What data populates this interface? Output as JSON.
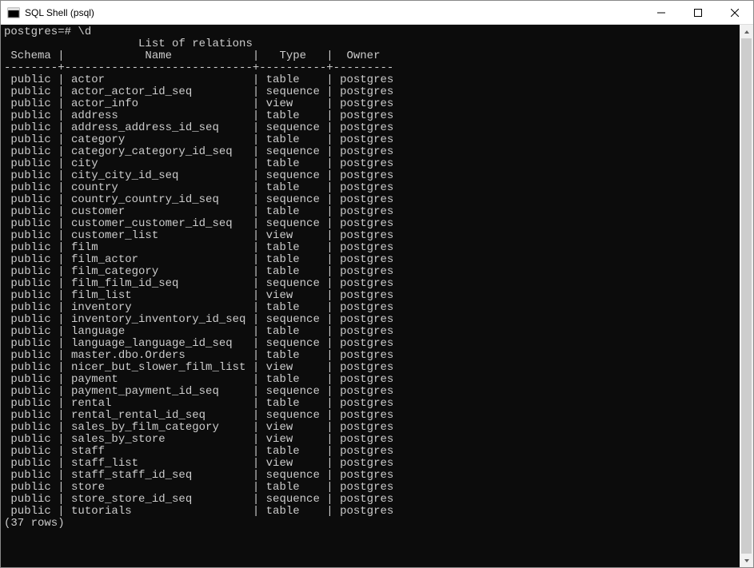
{
  "window": {
    "title": "SQL Shell (psql)"
  },
  "terminal": {
    "prompt": "postgres=# \\d",
    "list_title": "List of relations",
    "columns": {
      "schema": "Schema",
      "name": "Name",
      "type": "Type",
      "owner": "Owner"
    },
    "col_widths": {
      "schema": 8,
      "name": 28,
      "type": 10,
      "owner": 9
    },
    "rows": [
      {
        "schema": "public",
        "name": "actor",
        "type": "table",
        "owner": "postgres"
      },
      {
        "schema": "public",
        "name": "actor_actor_id_seq",
        "type": "sequence",
        "owner": "postgres"
      },
      {
        "schema": "public",
        "name": "actor_info",
        "type": "view",
        "owner": "postgres"
      },
      {
        "schema": "public",
        "name": "address",
        "type": "table",
        "owner": "postgres"
      },
      {
        "schema": "public",
        "name": "address_address_id_seq",
        "type": "sequence",
        "owner": "postgres"
      },
      {
        "schema": "public",
        "name": "category",
        "type": "table",
        "owner": "postgres"
      },
      {
        "schema": "public",
        "name": "category_category_id_seq",
        "type": "sequence",
        "owner": "postgres"
      },
      {
        "schema": "public",
        "name": "city",
        "type": "table",
        "owner": "postgres"
      },
      {
        "schema": "public",
        "name": "city_city_id_seq",
        "type": "sequence",
        "owner": "postgres"
      },
      {
        "schema": "public",
        "name": "country",
        "type": "table",
        "owner": "postgres"
      },
      {
        "schema": "public",
        "name": "country_country_id_seq",
        "type": "sequence",
        "owner": "postgres"
      },
      {
        "schema": "public",
        "name": "customer",
        "type": "table",
        "owner": "postgres"
      },
      {
        "schema": "public",
        "name": "customer_customer_id_seq",
        "type": "sequence",
        "owner": "postgres"
      },
      {
        "schema": "public",
        "name": "customer_list",
        "type": "view",
        "owner": "postgres"
      },
      {
        "schema": "public",
        "name": "film",
        "type": "table",
        "owner": "postgres"
      },
      {
        "schema": "public",
        "name": "film_actor",
        "type": "table",
        "owner": "postgres"
      },
      {
        "schema": "public",
        "name": "film_category",
        "type": "table",
        "owner": "postgres"
      },
      {
        "schema": "public",
        "name": "film_film_id_seq",
        "type": "sequence",
        "owner": "postgres"
      },
      {
        "schema": "public",
        "name": "film_list",
        "type": "view",
        "owner": "postgres"
      },
      {
        "schema": "public",
        "name": "inventory",
        "type": "table",
        "owner": "postgres"
      },
      {
        "schema": "public",
        "name": "inventory_inventory_id_seq",
        "type": "sequence",
        "owner": "postgres"
      },
      {
        "schema": "public",
        "name": "language",
        "type": "table",
        "owner": "postgres"
      },
      {
        "schema": "public",
        "name": "language_language_id_seq",
        "type": "sequence",
        "owner": "postgres"
      },
      {
        "schema": "public",
        "name": "master.dbo.Orders",
        "type": "table",
        "owner": "postgres"
      },
      {
        "schema": "public",
        "name": "nicer_but_slower_film_list",
        "type": "view",
        "owner": "postgres"
      },
      {
        "schema": "public",
        "name": "payment",
        "type": "table",
        "owner": "postgres"
      },
      {
        "schema": "public",
        "name": "payment_payment_id_seq",
        "type": "sequence",
        "owner": "postgres"
      },
      {
        "schema": "public",
        "name": "rental",
        "type": "table",
        "owner": "postgres"
      },
      {
        "schema": "public",
        "name": "rental_rental_id_seq",
        "type": "sequence",
        "owner": "postgres"
      },
      {
        "schema": "public",
        "name": "sales_by_film_category",
        "type": "view",
        "owner": "postgres"
      },
      {
        "schema": "public",
        "name": "sales_by_store",
        "type": "view",
        "owner": "postgres"
      },
      {
        "schema": "public",
        "name": "staff",
        "type": "table",
        "owner": "postgres"
      },
      {
        "schema": "public",
        "name": "staff_list",
        "type": "view",
        "owner": "postgres"
      },
      {
        "schema": "public",
        "name": "staff_staff_id_seq",
        "type": "sequence",
        "owner": "postgres"
      },
      {
        "schema": "public",
        "name": "store",
        "type": "table",
        "owner": "postgres"
      },
      {
        "schema": "public",
        "name": "store_store_id_seq",
        "type": "sequence",
        "owner": "postgres"
      },
      {
        "schema": "public",
        "name": "tutorials",
        "type": "table",
        "owner": "postgres"
      }
    ],
    "footer": "(37 rows)"
  }
}
